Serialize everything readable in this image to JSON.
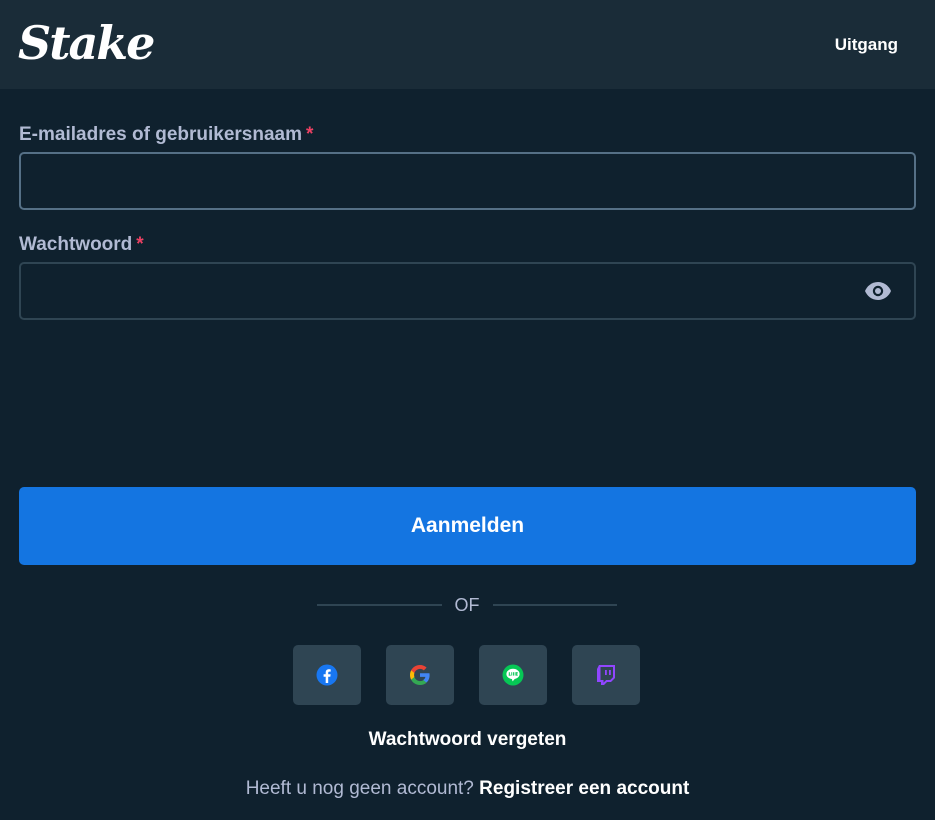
{
  "header": {
    "logo_text": "Stake",
    "exit_label": "Uitgang"
  },
  "form": {
    "email_label": "E-mailadres of gebruikersnaam",
    "email_value": "",
    "password_label": "Wachtwoord",
    "password_value": "",
    "required_marker": "*",
    "submit_label": "Aanmelden"
  },
  "divider_text": "OF",
  "social_buttons": [
    {
      "name": "facebook",
      "icon": "facebook-icon"
    },
    {
      "name": "google",
      "icon": "google-icon"
    },
    {
      "name": "line",
      "icon": "line-icon"
    },
    {
      "name": "twitch",
      "icon": "twitch-icon"
    }
  ],
  "forgot_password": "Wachtwoord vergeten",
  "register": {
    "prompt": "Heeft u nog geen account?",
    "link": "Registreer een account"
  },
  "colors": {
    "background": "#0f212e",
    "header": "#1a2c38",
    "accent": "#1475e1",
    "required": "#ed4163",
    "muted_text": "#b1bad3"
  }
}
